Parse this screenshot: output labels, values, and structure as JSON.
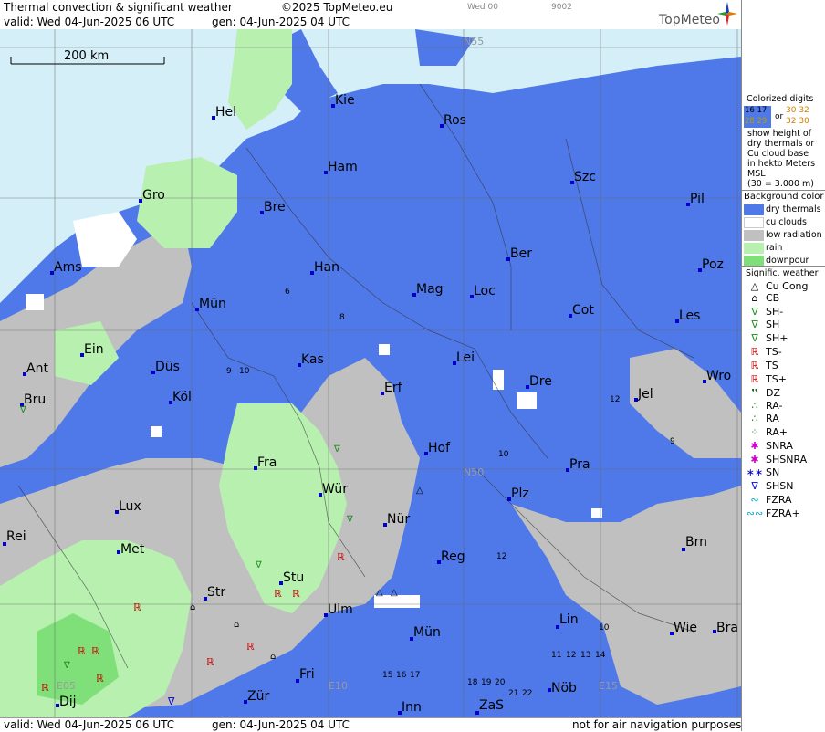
{
  "header": {
    "title": "Thermal convection & significant weather",
    "copyright": "©2025 TopMeteo.eu",
    "day_code": "Wed 00",
    "map_code": "9002",
    "valid": "valid:  Wed  04-Jun-2025  06 UTC",
    "gen": "gen: 04-Jun-2025 04 UTC",
    "logo": "TopMeteo"
  },
  "footer": {
    "valid": "valid:  Wed  04-Jun-2025  06 UTC",
    "gen": "gen: 04-Jun-2025 04 UTC",
    "notice": "not for air navigation purposes"
  },
  "map": {
    "scale_label": "200 km",
    "grid_labels": [
      "N55",
      "N50",
      "E10",
      "E15",
      "E05"
    ],
    "cities": [
      "Hel",
      "Kie",
      "Ros",
      "Ham",
      "Szc",
      "Gro",
      "Bre",
      "Pil",
      "Ams",
      "Han",
      "Ber",
      "Poz",
      "Mag",
      "Loc",
      "Mün",
      "Cot",
      "Les",
      "Ein",
      "Kas",
      "Lei",
      "Ant",
      "Düs",
      "Dre",
      "Wro",
      "Bru",
      "Köl",
      "Erf",
      "Jel",
      "Hof",
      "Fra",
      "Pra",
      "Lux",
      "Wür",
      "Plz",
      "Nür",
      "Rei",
      "Met",
      "Reg",
      "Brn",
      "Stu",
      "Str",
      "Ulm",
      "Lin",
      "Mün",
      "Wie",
      "Bra",
      "Fri",
      "Nöb",
      "Zür",
      "Inn",
      "Dij",
      "ZaS"
    ],
    "digit_samples": [
      "6",
      "8",
      "10",
      "12",
      "15",
      "16",
      "17",
      "18",
      "19",
      "20",
      "21",
      "22",
      "11",
      "13",
      "14",
      "9"
    ]
  },
  "legend": {
    "colorized_title": "Colorized digits",
    "sample_a1": "16 17",
    "sample_a2": "28 29",
    "sample_or": "or",
    "sample_b1": "30 32",
    "sample_b2": "32 30",
    "explain": [
      "show height of",
      "dry thermals or",
      "Cu cloud base",
      "in hekto Meters",
      "MSL",
      "(30 = 3.000 m)"
    ],
    "bg_title": "Background color",
    "bg_items": [
      {
        "label": "dry thermals",
        "color": "#4f78e8"
      },
      {
        "label": "cu clouds",
        "color": "#ffffff"
      },
      {
        "label": "low radiation",
        "color": "#c0c0c0"
      },
      {
        "label": "rain",
        "color": "#b8f0b0"
      },
      {
        "label": "downpour",
        "color": "#7fe07a"
      }
    ],
    "wx_title": "Signific. weather",
    "wx_items": [
      {
        "label": "Cu Cong",
        "symbol": "△",
        "color": "#000000"
      },
      {
        "label": "CB",
        "symbol": "⌂",
        "color": "#000000"
      },
      {
        "label": "SH-",
        "symbol": "∇",
        "color": "#1a8a1a"
      },
      {
        "label": "SH",
        "symbol": "∇",
        "color": "#1a8a1a"
      },
      {
        "label": "SH+",
        "symbol": "∇",
        "color": "#1a8a1a"
      },
      {
        "label": "TS-",
        "symbol": "ℝ",
        "color": "#cc0000"
      },
      {
        "label": "TS",
        "symbol": "ℝ",
        "color": "#cc0000"
      },
      {
        "label": "TS+",
        "symbol": "ℝ",
        "color": "#cc0000"
      },
      {
        "label": "DZ",
        "symbol": "❜❜",
        "color": "#1a6a1a"
      },
      {
        "label": "RA-",
        "symbol": "∴",
        "color": "#1a6a1a"
      },
      {
        "label": "RA",
        "symbol": "∴",
        "color": "#1a6a1a"
      },
      {
        "label": "RA+",
        "symbol": "⁘",
        "color": "#1a6a1a"
      },
      {
        "label": "SNRA",
        "symbol": "✱",
        "color": "#cc00cc"
      },
      {
        "label": "SHSNRA",
        "symbol": "✱",
        "color": "#cc00cc"
      },
      {
        "label": "SN",
        "symbol": "∗∗",
        "color": "#0000cc"
      },
      {
        "label": "SHSN",
        "symbol": "∇",
        "color": "#0000cc"
      },
      {
        "label": "FZRA",
        "symbol": "∾",
        "color": "#00aacc"
      },
      {
        "label": "FZRA+",
        "symbol": "∾∾",
        "color": "#00aacc"
      }
    ]
  }
}
